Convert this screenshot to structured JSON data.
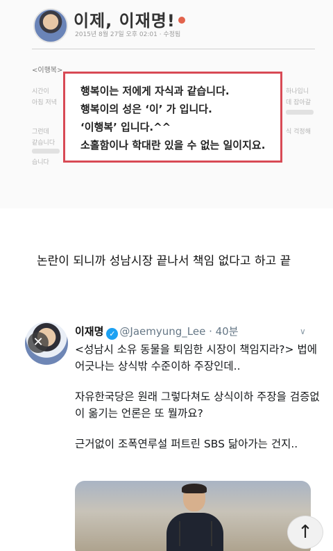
{
  "blog": {
    "title": "이제, 이재명!",
    "date": "2015년 8월 27일 오후 02:01 · 수정됨",
    "section": "<이행복>",
    "blurred": {
      "l1": "시간이",
      "r1": "하나입니",
      "l2": "아침 저녁",
      "r2": "데 잡아갈",
      "l3": "그런데",
      "r3": "식 걱정해",
      "l4": "같습니다",
      "l5": "습니다"
    },
    "quote_lines": [
      "행복이는 저에게 자식과 같습니다.",
      "행복이의 성은 ‘이’ 가 입니다.",
      "‘이행복’ 입니다.^^",
      "소홀함이나 학대란 있을 수 없는 일이지요."
    ]
  },
  "caption": "논란이 되니까 성남시장 끝나서 책임 없다고 하고 끝",
  "tweet": {
    "name": "이재명",
    "handle": "@Jaemyung_Lee · 40분",
    "verified_glyph": "✓",
    "chevron": "∨",
    "close_glyph": "✕",
    "paragraphs": [
      "<성남시 소유 동물을 퇴임한 시장이 책임지라?> 법에 어긋나는 상식밖 수준이하 주장인데..",
      "자유한국당은 원래 그렇다쳐도 상식이하 주장을 검증없이 옮기는 언론은 또 뭘까요?",
      "근거없이 조폭연루설 퍼트린 SBS 닮아가는 건지.."
    ]
  },
  "scroll_top_glyph": "↑",
  "icons": {
    "verified": "verified-badge-icon",
    "close": "close-icon",
    "chevron": "chevron-down-icon",
    "scroll": "arrow-up-icon"
  },
  "colors": {
    "quote_border": "#d84a55",
    "verified": "#1da1f2",
    "handle": "#657786"
  }
}
